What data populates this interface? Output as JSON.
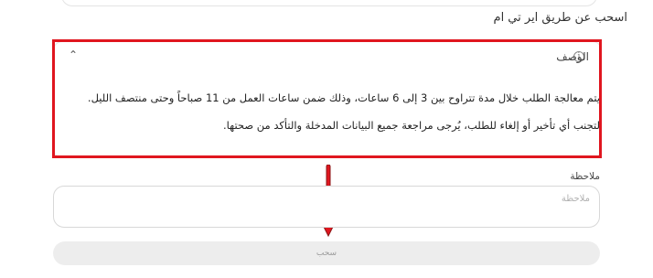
{
  "page": {
    "section_title": "اسحب عن طريق اير تي ام"
  },
  "description": {
    "title": "الوصف",
    "info_icon": "info-icon",
    "chevron_icon": "chevron-up-icon",
    "lines": [
      "يتم معالجة الطلب خلال مدة تتراوح بين 3 إلى 6 ساعات، وذلك ضمن ساعات العمل من 11 صباحاً وحتى منتصف الليل.",
      "لتجنب أي تأخير أو إلغاء للطلب، يُرجى مراجعة جميع البيانات المدخلة والتأكد من صحتها."
    ]
  },
  "notes": {
    "label": "ملاحظة",
    "placeholder": "ملاحظة",
    "value": ""
  },
  "actions": {
    "withdraw_label": "سحب"
  },
  "annotations": {
    "highlight_color": "#e0161f",
    "arrow_color": "#e0161f"
  }
}
